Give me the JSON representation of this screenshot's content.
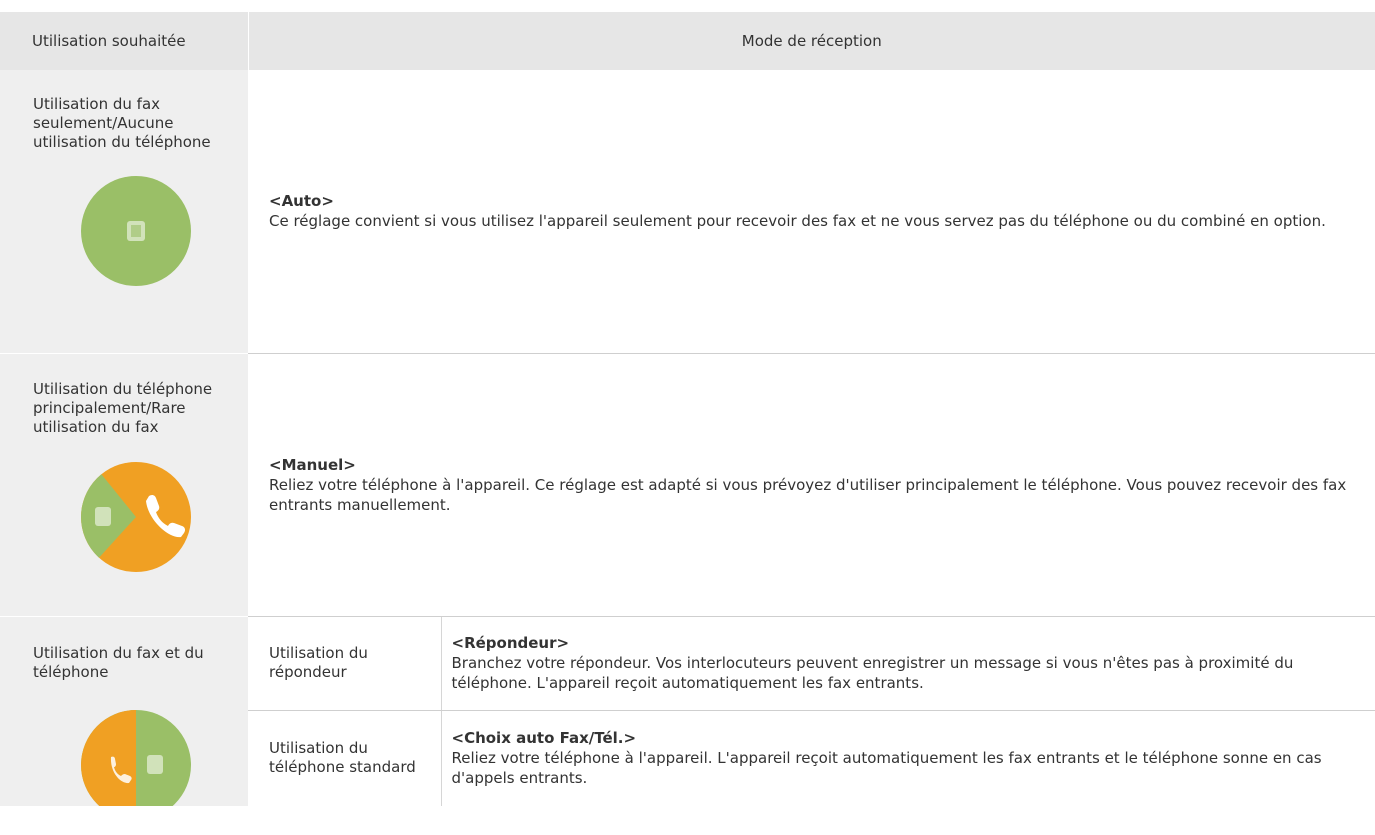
{
  "header": {
    "col1": "Utilisation souhaitée",
    "col2": "Mode de réception"
  },
  "rows": [
    {
      "usage": "Utilisation du fax seulement/Aucune utilisation du téléphone",
      "icon": "fax-only-icon",
      "mode_title": "<Auto>",
      "mode_text": "Ce réglage convient si vous utilisez l'appareil seulement pour recevoir des fax et ne vous servez pas du téléphone ou du combiné en option."
    },
    {
      "usage": "Utilisation du téléphone principalement/Rare utilisation du fax",
      "icon": "phone-mostly-icon",
      "mode_title": "<Manuel>",
      "mode_text": "Reliez votre téléphone à l'appareil. Ce réglage est adapté si vous prévoyez d'utiliser principalement le téléphone. Vous pouvez recevoir des fax entrants manuellement."
    },
    {
      "usage": "Utilisation du fax et du téléphone",
      "icon": "fax-and-phone-icon",
      "sub": [
        {
          "label": "Utilisation du répondeur",
          "mode_title": "<Répondeur>",
          "mode_text": "Branchez votre répondeur. Vos interlocuteurs peuvent enregistrer un message si vous n'êtes pas à proximité du téléphone. L'appareil reçoit automatiquement les fax entrants."
        },
        {
          "label": "Utilisation du téléphone standard",
          "mode_title": "<Choix auto Fax/Tél.>",
          "mode_text": "Reliez votre téléphone à l'appareil. L'appareil reçoit automatiquement les fax entrants et le téléphone sonne en cas d'appels entrants."
        }
      ]
    }
  ],
  "colors": {
    "fax_green": "#9abf67",
    "phone_orange": "#f0a023",
    "header_bg": "#e6e6e6",
    "usage_bg": "#efefef"
  }
}
